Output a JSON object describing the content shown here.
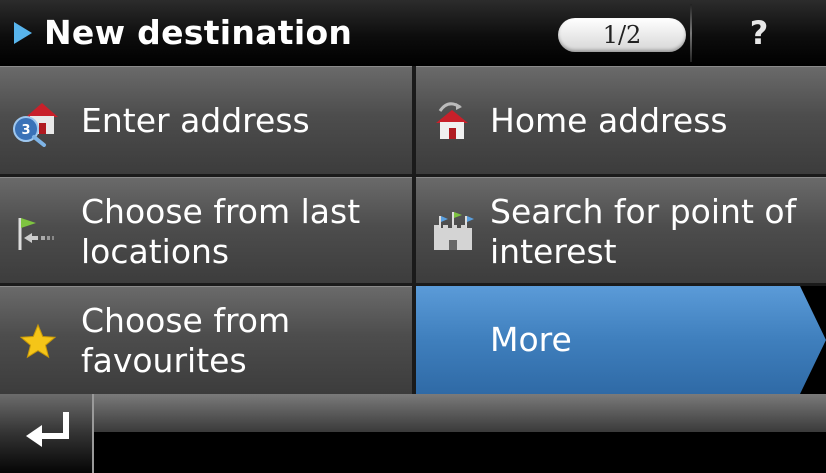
{
  "header": {
    "title": "New destination",
    "page_indicator": "1/2",
    "help_label": "?",
    "arrow_icon": "play-arrow-icon"
  },
  "menu": {
    "items": [
      {
        "label": "Enter address",
        "icon": "address-house-icon"
      },
      {
        "label": "Home address",
        "icon": "home-icon"
      },
      {
        "label": "Choose from last\nlocations",
        "icon": "recent-flag-icon"
      },
      {
        "label": "Search for point of\ninterest",
        "icon": "castle-poi-icon"
      },
      {
        "label": "Choose from\nfavourites",
        "icon": "star-icon"
      }
    ],
    "more_label": "More"
  },
  "footer": {
    "back_icon": "return-arrow-icon"
  },
  "colors": {
    "accent_blue": "#3f7fbd",
    "header_arrow": "#58b4ec",
    "tile_gray": "#4d4d4d"
  }
}
